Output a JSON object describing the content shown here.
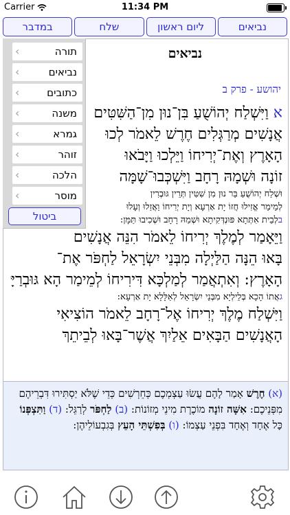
{
  "status_bar": {
    "carrier": "Carrier",
    "time": "11:34 PM"
  },
  "top_nav": [
    "במדבר",
    "שלח",
    "ליום ראשון",
    "נביאים"
  ],
  "book_title": "נביאים",
  "chapter_heading": "יהושע - פרק ב",
  "text_lines": [
    {
      "vn": "א",
      "text": " וַיִּשְׁלַח יְהוֹשֻׁעַ בִּן־נוּן מִן־הַשִּׁטִּים",
      "size": "big"
    },
    {
      "vn": "",
      "text": "אֲנָשִׁים מְרַגְּלִים חֶרֶשׁ לֵאמֹר לְכוּ",
      "size": "big"
    },
    {
      "vn": "",
      "text": "הָאָרֶץ וְאֶת־יְרִיחוֹ וַיֵּלְכוּ וַיָּבֹאוּ",
      "size": "big"
    },
    {
      "vn": "",
      "text": "זוֹנָה וּשְׁמָהּ רָחָב וַיִּשְׁכְּבוּ־שָׁמָּה",
      "size": "big"
    },
    {
      "vn": "",
      "text": "וּשְׁלַח יְהוֹשֻׁעַ בַּר נוּן מִן שִׁטִּין תְּרֵין גּוּבְרִין",
      "size": "small"
    },
    {
      "vn": "",
      "text": "לְמֵימַר אֱזִילוּ חֲזוֹ יָת אַרְעָא וְיָת יְרִיחוֹ וַאֲזַלוּ וְעָלוּ",
      "size": "small"
    },
    {
      "vn": "ב",
      "text": "לְבֵית אִתְּתָא פּוּנְדְּקִיתָא וּשְׁמַהּ רָחָב וּשְׁכִיבוּ תַּמָּן:",
      "size": "small"
    },
    {
      "vn": "",
      "text": "וַיֵּאָמַר לְמֶלֶךְ יְרִיחוֹ לֵאמֹר הִנֵּה אֲנָשִׁים",
      "size": "big"
    },
    {
      "vn": "",
      "text": "בָּאוּ הֵנָּה הַלַּיְלָה מִבְּנֵי יִשְׂרָאֵל לַחְפֹּר אֶת־",
      "size": "big"
    },
    {
      "vn": "",
      "text": "הָאָרֶץ: וְאִתְאֲמַר לְמַלְכָּא דִּירִיחוֹ לְמֵימַר הָא גּוּבְרַיָּא",
      "size": "big"
    },
    {
      "vn": "ג",
      "text": "אֲתוֹ הָכָא בְּלֵילְיָא מִבְּנֵי יִשְׂרָאֵל לְאַלָּלָא יָת אַרְעָא:",
      "size": "small"
    },
    {
      "vn": "",
      "text": "וַיִּשְׁלַח מֶלֶךְ יְרִיחוֹ אֶל־רָחָב לֵאמֹר הוֹצִיאִי",
      "size": "big"
    },
    {
      "vn": "",
      "text": "הָאֲנָשִׁים הַבָּאִים אֵלַיִךְ אֲשֶׁר־בָּאוּ לְבֵיתֵךְ",
      "size": "big"
    }
  ],
  "menu": {
    "items": [
      "תורה",
      "נביאים",
      "כתובים",
      "משנה",
      "גמרא",
      "זוהר",
      "הלכה",
      "מוסר"
    ],
    "cancel": "ביטול"
  },
  "commentary": {
    "segments": [
      {
        "t": "(א) ",
        "c": "m"
      },
      {
        "t": "חֶרֶשׁ",
        "c": "b"
      },
      {
        "t": " אָמַר לָהֶם עֲשׂוּ עַצְמְכֶם כְּחֵרְשִׁים כְּדֵי שֶׁלֹּא יַסְתִּירוּ דִּבְרֵיהֶם מִפְּנֵיכֶם: ",
        "c": ""
      },
      {
        "t": "אִשָּׁה זוֹנָה",
        "c": "b"
      },
      {
        "t": " מוֹכֶרֶת מִינֵי מְזוֹנוֹת: ",
        "c": ""
      },
      {
        "t": "(ב) ",
        "c": "m"
      },
      {
        "t": "לַחְפֹּר",
        "c": "b"
      },
      {
        "t": " לְרַגֵּל: ",
        "c": ""
      },
      {
        "t": "(ד) ",
        "c": "m"
      },
      {
        "t": "וַתִּצְפְּנוֹ",
        "c": "b"
      },
      {
        "t": " כָּל אֶחָד וְאֶחָד בִּפְנֵי עַצְמוֹ: ",
        "c": ""
      },
      {
        "t": "(ו) ",
        "c": "m"
      },
      {
        "t": "בְּפִשְׁתֵּי הָעֵץ",
        "c": "b"
      },
      {
        "t": " בְּגִבְעוֹלֵיהֶן:",
        "c": ""
      }
    ]
  },
  "toolbar": {
    "icons": [
      "info-icon",
      "home-icon",
      "arrow-down-icon",
      "arrow-up-icon",
      "settings-gear-icon"
    ],
    "icon_color": "#555555"
  },
  "colors": {
    "accent": "#2a2ad0",
    "commentary_bg": "#e9f0fb"
  }
}
